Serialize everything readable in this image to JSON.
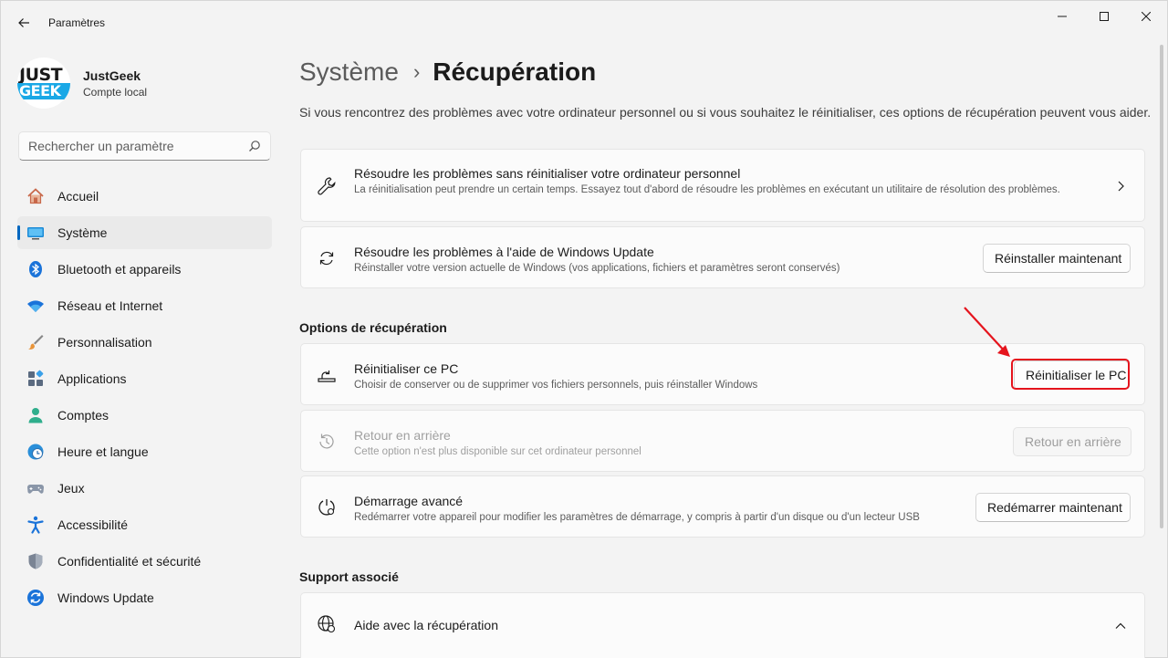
{
  "window": {
    "title": "Paramètres"
  },
  "profile": {
    "logo_top": "JUST",
    "logo_bottom": "GEEK",
    "name": "JustGeek",
    "account": "Compte local"
  },
  "search": {
    "placeholder": "Rechercher un paramètre"
  },
  "sidebar": {
    "items": [
      {
        "label": "Accueil",
        "icon": "home-icon"
      },
      {
        "label": "Système",
        "icon": "monitor-icon",
        "active": true
      },
      {
        "label": "Bluetooth et appareils",
        "icon": "bluetooth-icon"
      },
      {
        "label": "Réseau et Internet",
        "icon": "wifi-icon"
      },
      {
        "label": "Personnalisation",
        "icon": "brush-icon"
      },
      {
        "label": "Applications",
        "icon": "apps-icon"
      },
      {
        "label": "Comptes",
        "icon": "person-icon"
      },
      {
        "label": "Heure et langue",
        "icon": "clock-globe-icon"
      },
      {
        "label": "Jeux",
        "icon": "gamepad-icon"
      },
      {
        "label": "Accessibilité",
        "icon": "accessibility-icon"
      },
      {
        "label": "Confidentialité et sécurité",
        "icon": "shield-icon"
      },
      {
        "label": "Windows Update",
        "icon": "update-icon"
      }
    ]
  },
  "header": {
    "parent": "Système",
    "separator": "›",
    "current": "Récupération"
  },
  "intro": "Si vous rencontrez des problèmes avec votre ordinateur personnel ou si vous souhaitez le réinitialiser, ces options de récupération peuvent vous aider.",
  "cards": {
    "troubleshoot": {
      "title": "Résoudre les problèmes sans réinitialiser votre ordinateur personnel",
      "desc": "La réinitialisation peut prendre un certain temps. Essayez tout d'abord de résoudre les problèmes en exécutant un utilitaire de résolution des problèmes."
    },
    "windows_update": {
      "title": "Résoudre les problèmes à l'aide de Windows Update",
      "desc": "Réinstaller votre version actuelle de Windows (vos applications, fichiers et paramètres seront conservés)",
      "button": "Réinstaller maintenant"
    }
  },
  "recovery_section": {
    "title": "Options de récupération",
    "reset": {
      "title": "Réinitialiser ce PC",
      "desc": "Choisir de conserver ou de supprimer vos fichiers personnels, puis réinstaller Windows",
      "button": "Réinitialiser le PC"
    },
    "go_back": {
      "title": "Retour en arrière",
      "desc": "Cette option n'est plus disponible sur cet ordinateur personnel",
      "button": "Retour en arrière"
    },
    "advanced": {
      "title": "Démarrage avancé",
      "desc": "Redémarrer votre appareil pour modifier les paramètres de démarrage, y compris à partir d'un disque ou d'un lecteur USB",
      "button": "Redémarrer maintenant"
    }
  },
  "support_section": {
    "title": "Support associé",
    "help": {
      "title": "Aide avec la récupération"
    }
  },
  "colors": {
    "accent": "#0067c0",
    "highlight": "#e5141d",
    "background": "#f3f3f3",
    "card": "#fbfbfb"
  }
}
